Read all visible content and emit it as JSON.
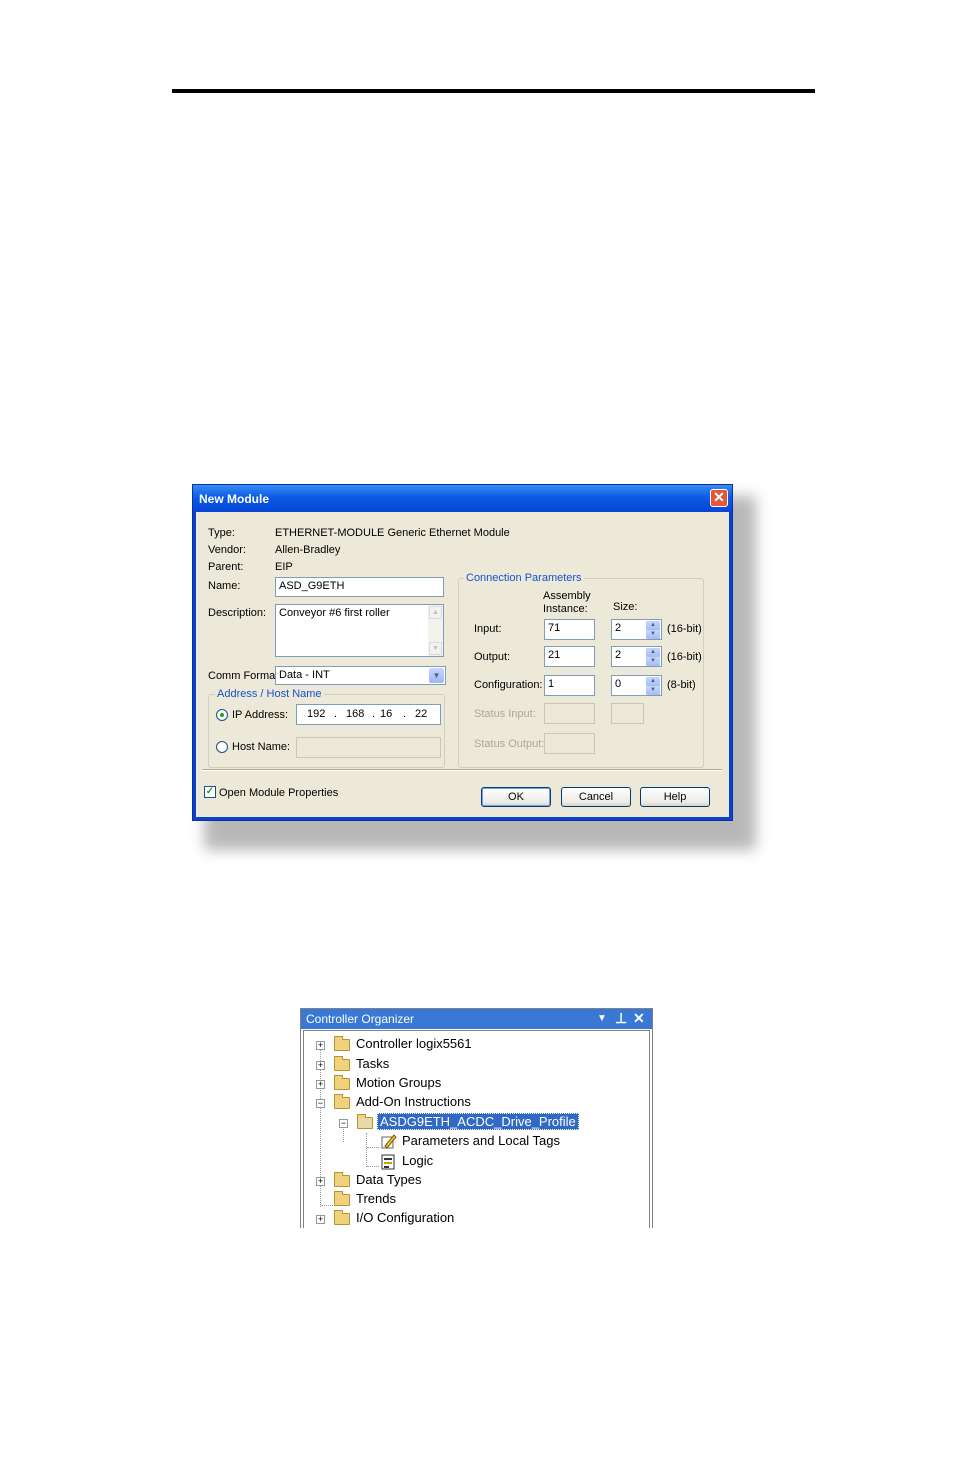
{
  "dialog": {
    "title": "New Module",
    "close_glyph": "✕",
    "type_label": "Type:",
    "type_value": "ETHERNET-MODULE Generic Ethernet Module",
    "vendor_label": "Vendor:",
    "vendor_value": "Allen-Bradley",
    "parent_label": "Parent:",
    "parent_value": "EIP",
    "name_label": "Name:",
    "name_value": "ASD_G9ETH",
    "description_label": "Description:",
    "description_value": "Conveyor #6 first roller",
    "comm_format_label": "Comm Format:",
    "comm_format_value": "Data - INT",
    "address_group_title": "Address / Host Name",
    "ip_label": "IP Address:",
    "ip_octets": [
      "192",
      "168",
      "16",
      "22"
    ],
    "host_label": "Host Name:",
    "conn_group_title": "Connection Parameters",
    "assembly_header": "Assembly Instance:",
    "size_header": "Size:",
    "rows": {
      "input": {
        "label": "Input:",
        "assembly": "71",
        "size": "2",
        "unit": "(16-bit)"
      },
      "output": {
        "label": "Output:",
        "assembly": "21",
        "size": "2",
        "unit": "(16-bit)"
      },
      "config": {
        "label": "Configuration:",
        "assembly": "1",
        "size": "0",
        "unit": "(8-bit)"
      },
      "status_input": {
        "label": "Status Input:"
      },
      "status_output": {
        "label": "Status Output:"
      }
    },
    "open_props_label": "Open Module Properties",
    "buttons": {
      "ok": "OK",
      "cancel": "Cancel",
      "help": "Help"
    }
  },
  "organizer": {
    "title": "Controller Organizer",
    "controls": {
      "dropdown": "▼",
      "pin": "⊥",
      "close": "✕"
    },
    "items": [
      {
        "label": "Controller logix5561",
        "expander": "+"
      },
      {
        "label": "Tasks",
        "expander": "+"
      },
      {
        "label": "Motion Groups",
        "expander": "+"
      },
      {
        "label": "Add-On Instructions",
        "expander": "−"
      },
      {
        "label": "ASDG9ETH_ACDC_Drive_Profile",
        "expander": "−"
      },
      {
        "label": "Parameters and Local Tags"
      },
      {
        "label": "Logic"
      },
      {
        "label": "Data Types",
        "expander": "+"
      },
      {
        "label": "Trends"
      },
      {
        "label": "I/O Configuration",
        "expander": "+"
      }
    ]
  }
}
